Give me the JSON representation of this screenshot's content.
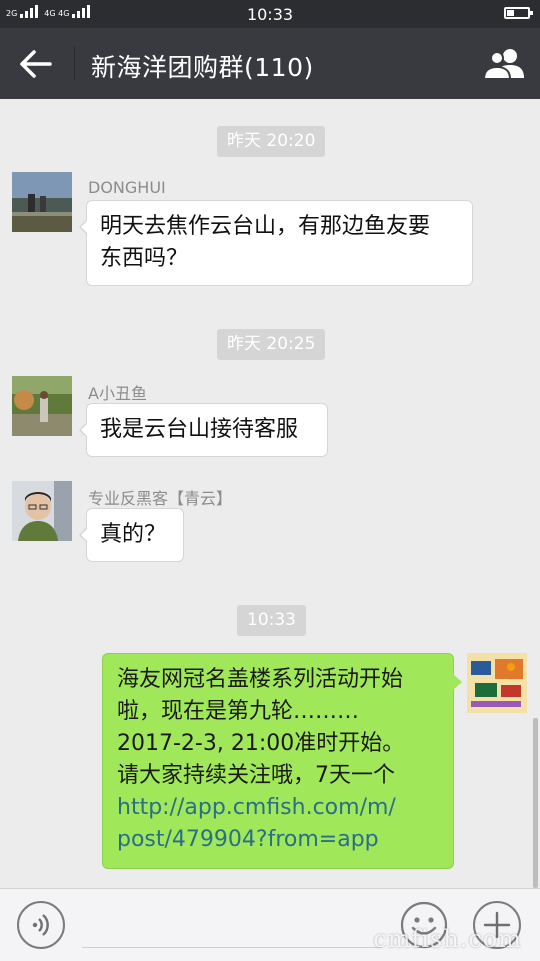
{
  "status_bar": {
    "time": "10:33",
    "sim1_label": "2G",
    "sim2_label": "4G 4G"
  },
  "header": {
    "title": "新海洋团购群(110)"
  },
  "messages": [
    {
      "type": "time",
      "text": "昨天 20:20"
    },
    {
      "type": "incoming",
      "sender": "DONGHUI",
      "lines": [
        "明天去焦作云台山，有那边鱼友要",
        "东西吗？"
      ]
    },
    {
      "type": "time",
      "text": "昨天 20:25"
    },
    {
      "type": "incoming",
      "sender": "A小丑鱼",
      "lines": [
        "我是云台山接待客服"
      ]
    },
    {
      "type": "incoming",
      "sender": "专业反黑客【青云】",
      "lines": [
        "真的？"
      ]
    },
    {
      "type": "time",
      "text": "10:33"
    },
    {
      "type": "outgoing",
      "lines": [
        "海友网冠名盖楼系列活动开始",
        "啦，现在是第九轮………",
        "2017-2-3, 21:00准时开始。",
        "请大家持续关注哦，7天一个"
      ],
      "link_lines": [
        "http://app.cmfish.com/m/",
        "post/479904?from=app"
      ]
    }
  ],
  "input_bar": {
    "placeholder": "",
    "voice_icon": "voice-icon",
    "emoji_icon": "emoji-icon",
    "plus_icon": "plus-icon"
  },
  "watermark": "cmfish.com",
  "colors": {
    "header_bg": "#393a3f",
    "chat_bg": "#ececec",
    "outgoing_bubble": "#a0e75a",
    "link": "#2a6f86"
  }
}
